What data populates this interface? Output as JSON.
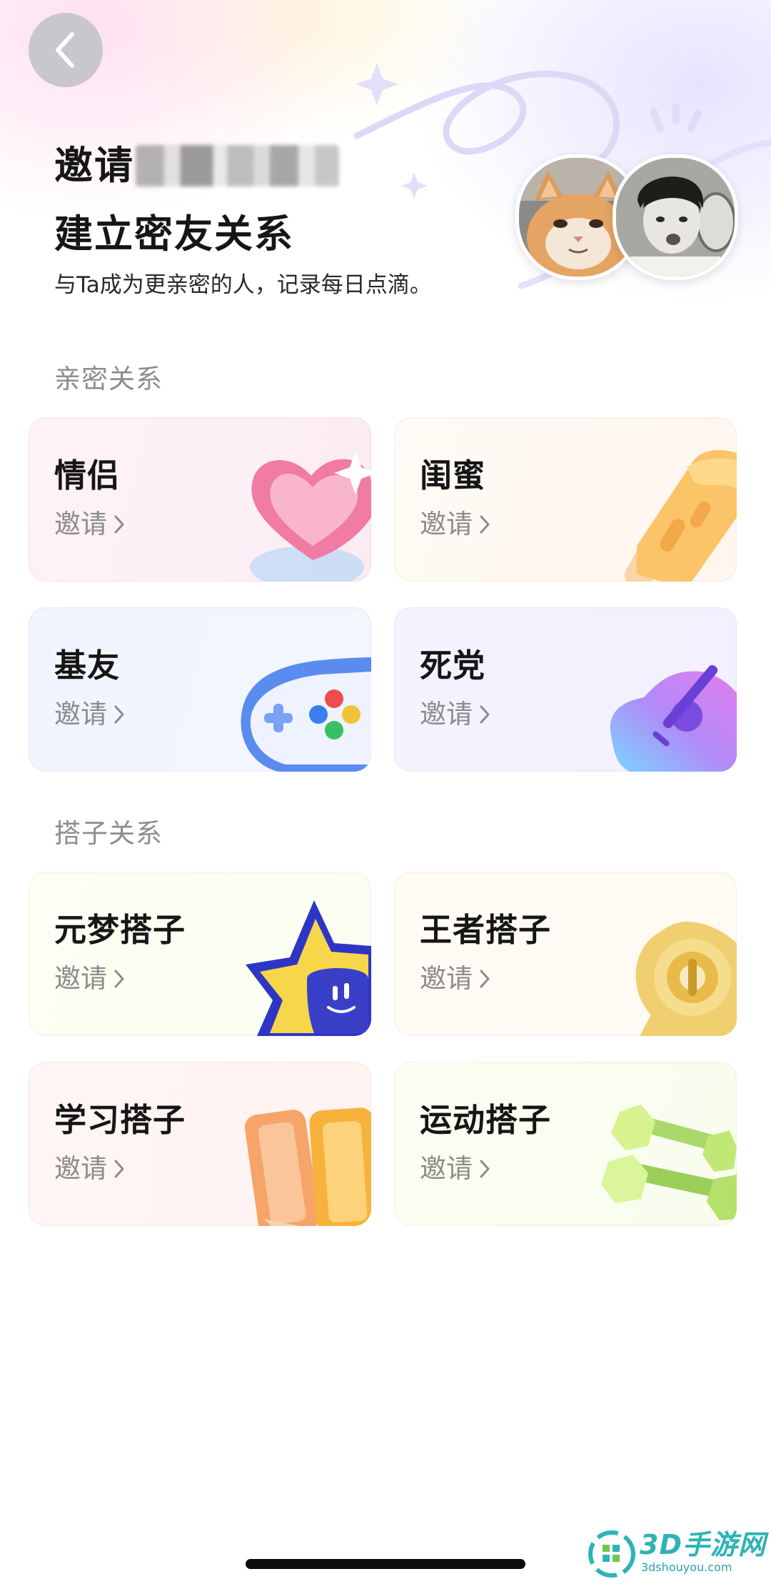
{
  "header": {
    "back_icon": "chevron-left-icon",
    "title_prefix": "邀请",
    "title_line2": "建立密友关系",
    "subtitle": "与Ta成为更亲密的人，记录每日点滴。"
  },
  "sections": [
    {
      "title": "亲密关系",
      "cards": [
        {
          "title": "情侣",
          "invite": "邀请",
          "icon": "heart-icon"
        },
        {
          "title": "闺蜜",
          "invite": "邀请",
          "icon": "popsicle-icon"
        },
        {
          "title": "基友",
          "invite": "邀请",
          "icon": "gamepad-icon"
        },
        {
          "title": "死党",
          "invite": "邀请",
          "icon": "guitar-icon"
        }
      ]
    },
    {
      "title": "搭子关系",
      "cards": [
        {
          "title": "元梦搭子",
          "invite": "邀请",
          "icon": "star-mascot-icon"
        },
        {
          "title": "王者搭子",
          "invite": "邀请",
          "icon": "gold-emblem-icon"
        },
        {
          "title": "学习搭子",
          "invite": "邀请",
          "icon": "pencils-icon"
        },
        {
          "title": "运动搭子",
          "invite": "邀请",
          "icon": "dumbbell-icon"
        }
      ]
    }
  ],
  "watermark": {
    "title": "3D手游网",
    "subtitle": "3dshouyou.com"
  },
  "colors": {
    "watermark": "#2fb3b5",
    "back_button": "#c9c6cc"
  }
}
